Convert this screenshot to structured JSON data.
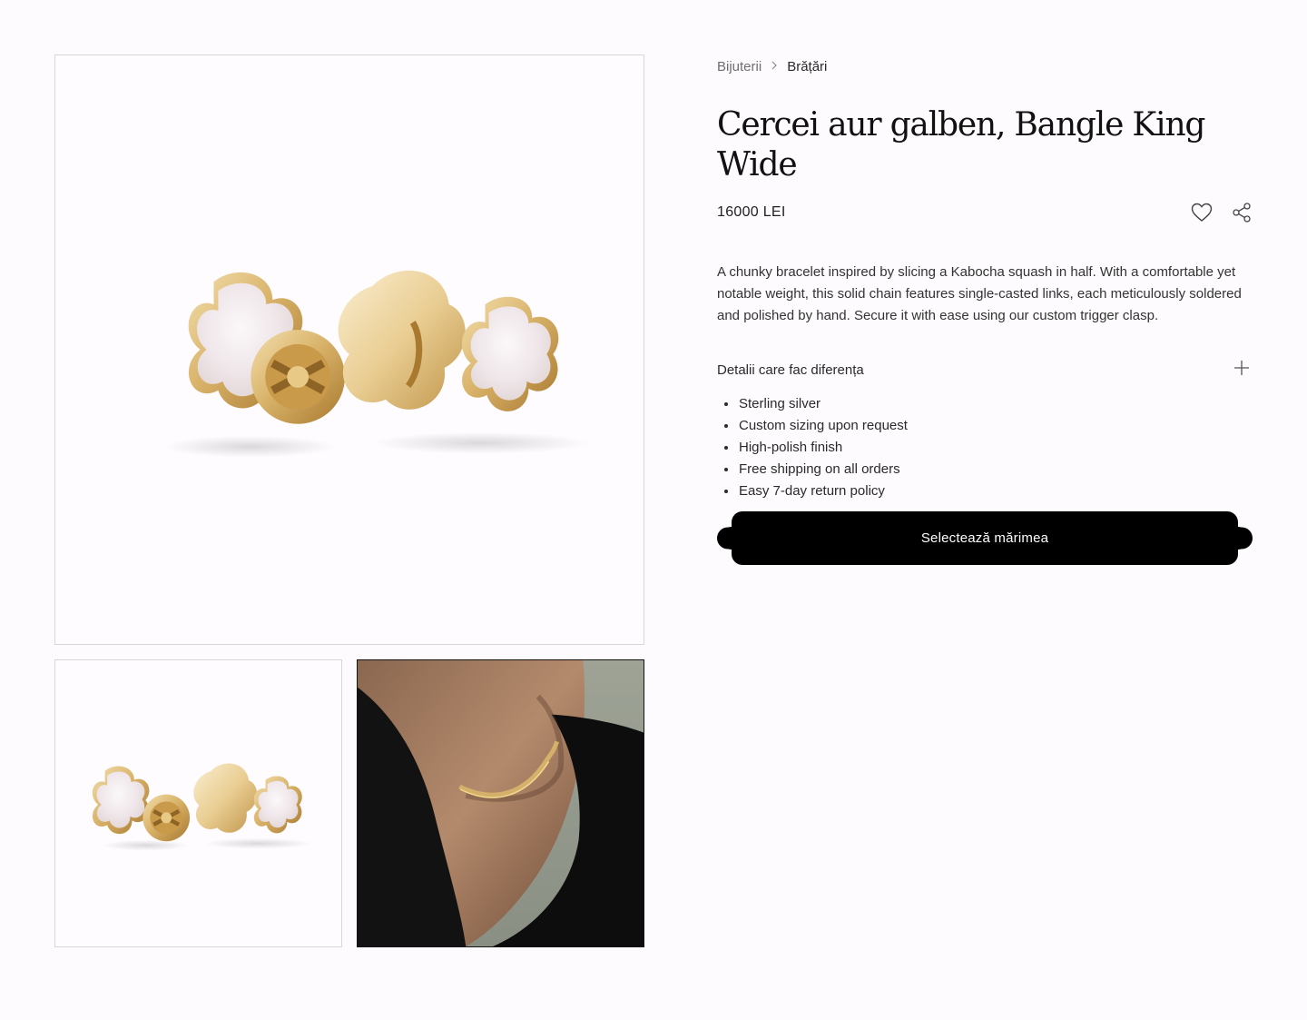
{
  "breadcrumb": {
    "parent": "Bijuterii",
    "current": "Brățări"
  },
  "product": {
    "title": "Cercei aur galben, Bangle King Wide",
    "price": "16000 LEI",
    "description": "A chunky bracelet inspired by slicing a Kabocha squash in half. With a comfortable yet notable weight, this solid chain features single-casted links, each meticulously soldered and polished by hand. Secure it with ease using our custom trigger clasp."
  },
  "details": {
    "heading": "Detalii care fac diferența",
    "items": [
      "Sterling silver",
      "Custom sizing upon request",
      "High-polish finish",
      "Free shipping on all orders",
      "Easy 7-day return policy"
    ]
  },
  "cta": {
    "label": "Selectează mărimea"
  },
  "icons": {
    "wishlist": "heart-icon",
    "share": "share-icon",
    "expand": "plus-icon",
    "breadcrumb_separator": "chevron-right-icon"
  },
  "colors": {
    "gold": "#d8b56a",
    "pearl": "#f4eef0",
    "button": "#000000",
    "background": "#fdfbfd"
  }
}
